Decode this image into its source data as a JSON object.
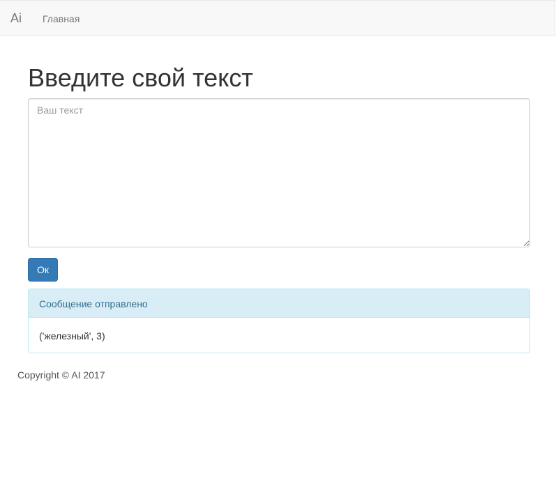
{
  "navbar": {
    "brand": "Ai",
    "links": [
      {
        "label": "Главная"
      }
    ]
  },
  "main": {
    "title": "Введите свой текст",
    "textarea": {
      "value": "",
      "placeholder": "Ваш текст"
    },
    "submit_label": "Ок",
    "result_panel": {
      "heading": "Сообщение отправлено",
      "body": "('железный', 3)"
    }
  },
  "footer": {
    "text": "Copyright © AI 2017"
  },
  "colors": {
    "primary": "#337ab7",
    "info_bg": "#d9edf7",
    "info_border": "#bce8f1",
    "info_text": "#31708f",
    "navbar_bg": "#f8f8f8"
  }
}
